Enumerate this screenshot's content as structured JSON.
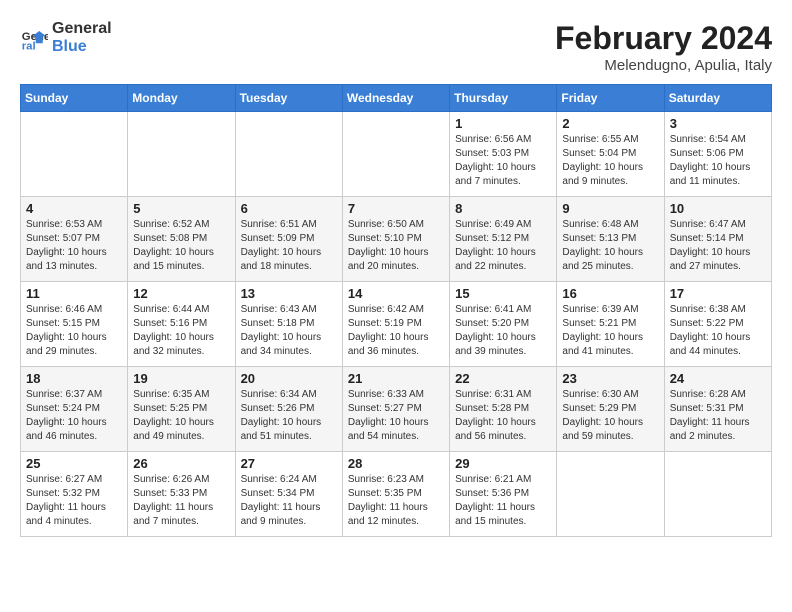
{
  "header": {
    "logo_line1": "General",
    "logo_line2": "Blue",
    "title": "February 2024",
    "subtitle": "Melendugno, Apulia, Italy"
  },
  "weekdays": [
    "Sunday",
    "Monday",
    "Tuesday",
    "Wednesday",
    "Thursday",
    "Friday",
    "Saturday"
  ],
  "weeks": [
    [
      {
        "day": "",
        "info": ""
      },
      {
        "day": "",
        "info": ""
      },
      {
        "day": "",
        "info": ""
      },
      {
        "day": "",
        "info": ""
      },
      {
        "day": "1",
        "info": "Sunrise: 6:56 AM\nSunset: 5:03 PM\nDaylight: 10 hours\nand 7 minutes."
      },
      {
        "day": "2",
        "info": "Sunrise: 6:55 AM\nSunset: 5:04 PM\nDaylight: 10 hours\nand 9 minutes."
      },
      {
        "day": "3",
        "info": "Sunrise: 6:54 AM\nSunset: 5:06 PM\nDaylight: 10 hours\nand 11 minutes."
      }
    ],
    [
      {
        "day": "4",
        "info": "Sunrise: 6:53 AM\nSunset: 5:07 PM\nDaylight: 10 hours\nand 13 minutes."
      },
      {
        "day": "5",
        "info": "Sunrise: 6:52 AM\nSunset: 5:08 PM\nDaylight: 10 hours\nand 15 minutes."
      },
      {
        "day": "6",
        "info": "Sunrise: 6:51 AM\nSunset: 5:09 PM\nDaylight: 10 hours\nand 18 minutes."
      },
      {
        "day": "7",
        "info": "Sunrise: 6:50 AM\nSunset: 5:10 PM\nDaylight: 10 hours\nand 20 minutes."
      },
      {
        "day": "8",
        "info": "Sunrise: 6:49 AM\nSunset: 5:12 PM\nDaylight: 10 hours\nand 22 minutes."
      },
      {
        "day": "9",
        "info": "Sunrise: 6:48 AM\nSunset: 5:13 PM\nDaylight: 10 hours\nand 25 minutes."
      },
      {
        "day": "10",
        "info": "Sunrise: 6:47 AM\nSunset: 5:14 PM\nDaylight: 10 hours\nand 27 minutes."
      }
    ],
    [
      {
        "day": "11",
        "info": "Sunrise: 6:46 AM\nSunset: 5:15 PM\nDaylight: 10 hours\nand 29 minutes."
      },
      {
        "day": "12",
        "info": "Sunrise: 6:44 AM\nSunset: 5:16 PM\nDaylight: 10 hours\nand 32 minutes."
      },
      {
        "day": "13",
        "info": "Sunrise: 6:43 AM\nSunset: 5:18 PM\nDaylight: 10 hours\nand 34 minutes."
      },
      {
        "day": "14",
        "info": "Sunrise: 6:42 AM\nSunset: 5:19 PM\nDaylight: 10 hours\nand 36 minutes."
      },
      {
        "day": "15",
        "info": "Sunrise: 6:41 AM\nSunset: 5:20 PM\nDaylight: 10 hours\nand 39 minutes."
      },
      {
        "day": "16",
        "info": "Sunrise: 6:39 AM\nSunset: 5:21 PM\nDaylight: 10 hours\nand 41 minutes."
      },
      {
        "day": "17",
        "info": "Sunrise: 6:38 AM\nSunset: 5:22 PM\nDaylight: 10 hours\nand 44 minutes."
      }
    ],
    [
      {
        "day": "18",
        "info": "Sunrise: 6:37 AM\nSunset: 5:24 PM\nDaylight: 10 hours\nand 46 minutes."
      },
      {
        "day": "19",
        "info": "Sunrise: 6:35 AM\nSunset: 5:25 PM\nDaylight: 10 hours\nand 49 minutes."
      },
      {
        "day": "20",
        "info": "Sunrise: 6:34 AM\nSunset: 5:26 PM\nDaylight: 10 hours\nand 51 minutes."
      },
      {
        "day": "21",
        "info": "Sunrise: 6:33 AM\nSunset: 5:27 PM\nDaylight: 10 hours\nand 54 minutes."
      },
      {
        "day": "22",
        "info": "Sunrise: 6:31 AM\nSunset: 5:28 PM\nDaylight: 10 hours\nand 56 minutes."
      },
      {
        "day": "23",
        "info": "Sunrise: 6:30 AM\nSunset: 5:29 PM\nDaylight: 10 hours\nand 59 minutes."
      },
      {
        "day": "24",
        "info": "Sunrise: 6:28 AM\nSunset: 5:31 PM\nDaylight: 11 hours\nand 2 minutes."
      }
    ],
    [
      {
        "day": "25",
        "info": "Sunrise: 6:27 AM\nSunset: 5:32 PM\nDaylight: 11 hours\nand 4 minutes."
      },
      {
        "day": "26",
        "info": "Sunrise: 6:26 AM\nSunset: 5:33 PM\nDaylight: 11 hours\nand 7 minutes."
      },
      {
        "day": "27",
        "info": "Sunrise: 6:24 AM\nSunset: 5:34 PM\nDaylight: 11 hours\nand 9 minutes."
      },
      {
        "day": "28",
        "info": "Sunrise: 6:23 AM\nSunset: 5:35 PM\nDaylight: 11 hours\nand 12 minutes."
      },
      {
        "day": "29",
        "info": "Sunrise: 6:21 AM\nSunset: 5:36 PM\nDaylight: 11 hours\nand 15 minutes."
      },
      {
        "day": "",
        "info": ""
      },
      {
        "day": "",
        "info": ""
      }
    ]
  ]
}
